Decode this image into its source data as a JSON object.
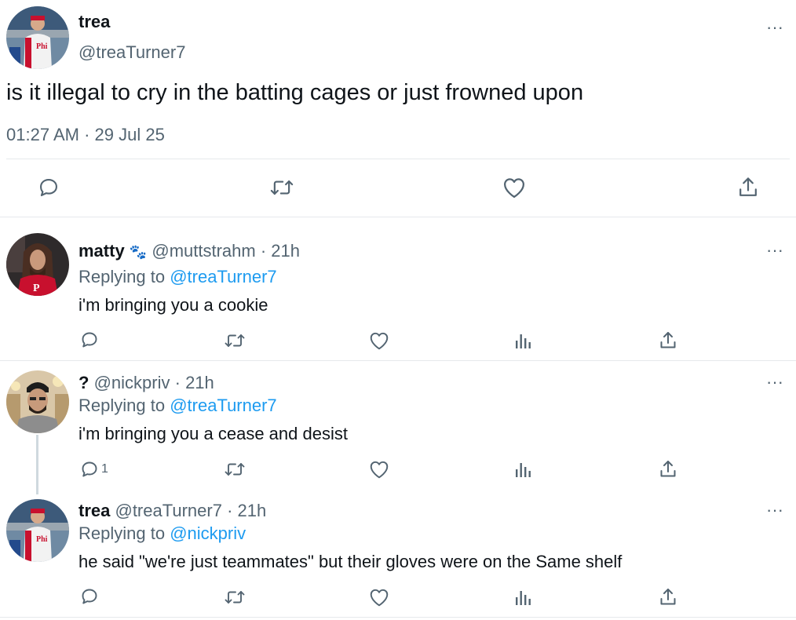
{
  "main_tweet": {
    "display_name": "trea",
    "handle": "@treaTurner7",
    "text": "is it illegal to cry in the batting cages or just frowned upon",
    "time": "01:27 AM",
    "date_sep": "·",
    "date": "29 Jul 25",
    "more_label": "···",
    "icons": [
      "reply-icon",
      "retweet-icon",
      "like-icon",
      "share-icon"
    ]
  },
  "replies": [
    {
      "display_name": "matty",
      "name_emoji": "🐾",
      "handle": "@muttstrahm",
      "sep": "·",
      "time": "21h",
      "replying_prefix": "Replying to",
      "replying_to": "@treaTurner7",
      "text": "i'm bringing you a cookie",
      "reply_count": "",
      "more_label": "···"
    },
    {
      "display_name": "?",
      "handle": "@nickpriv",
      "sep": "·",
      "time": "21h",
      "replying_prefix": "Replying to",
      "replying_to": "@treaTurner7",
      "text": "i'm bringing you a cease and desist",
      "reply_count": "1",
      "more_label": "···"
    },
    {
      "display_name": "trea",
      "handle": "@treaTurner7",
      "sep": "·",
      "time": "21h",
      "replying_prefix": "Replying to",
      "replying_to": "@nickpriv",
      "text": "he said \"we're just teammates\" but their gloves were on the Same shelf",
      "reply_count": "",
      "more_label": "···"
    }
  ],
  "colors": {
    "text": "#0f1419",
    "secondary": "#536471",
    "link": "#1d9bf0",
    "divider": "#e6e9ec",
    "phillies_red": "#c8102e"
  }
}
